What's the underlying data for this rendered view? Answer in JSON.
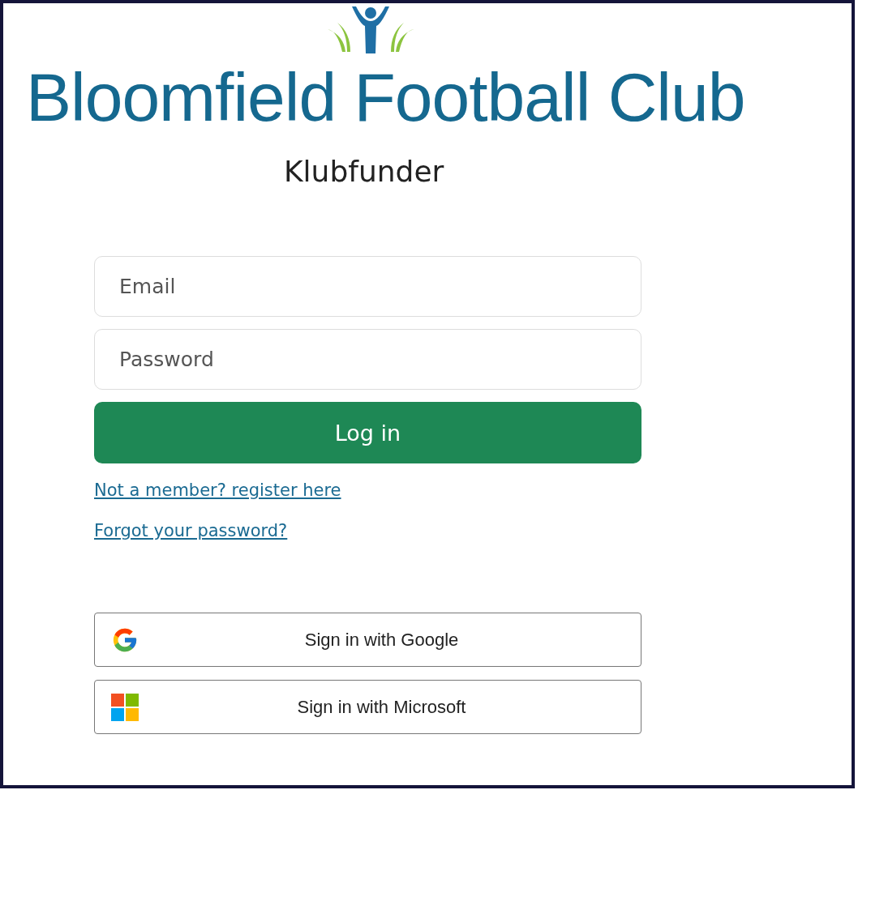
{
  "club_name": "Bloomfield Football Club",
  "app_name": "Klubfunder",
  "form": {
    "email": {
      "placeholder": "Email"
    },
    "password": {
      "placeholder": "Password"
    },
    "submit": "Log in"
  },
  "links": [
    {
      "label": "Not a member? register here"
    },
    {
      "label": "Forgot your password?"
    }
  ],
  "sso_buttons": [
    {
      "kind": "google",
      "label": "Sign in with Google"
    },
    {
      "kind": "microsoft",
      "label": "Sign in with Microsoft"
    }
  ]
}
